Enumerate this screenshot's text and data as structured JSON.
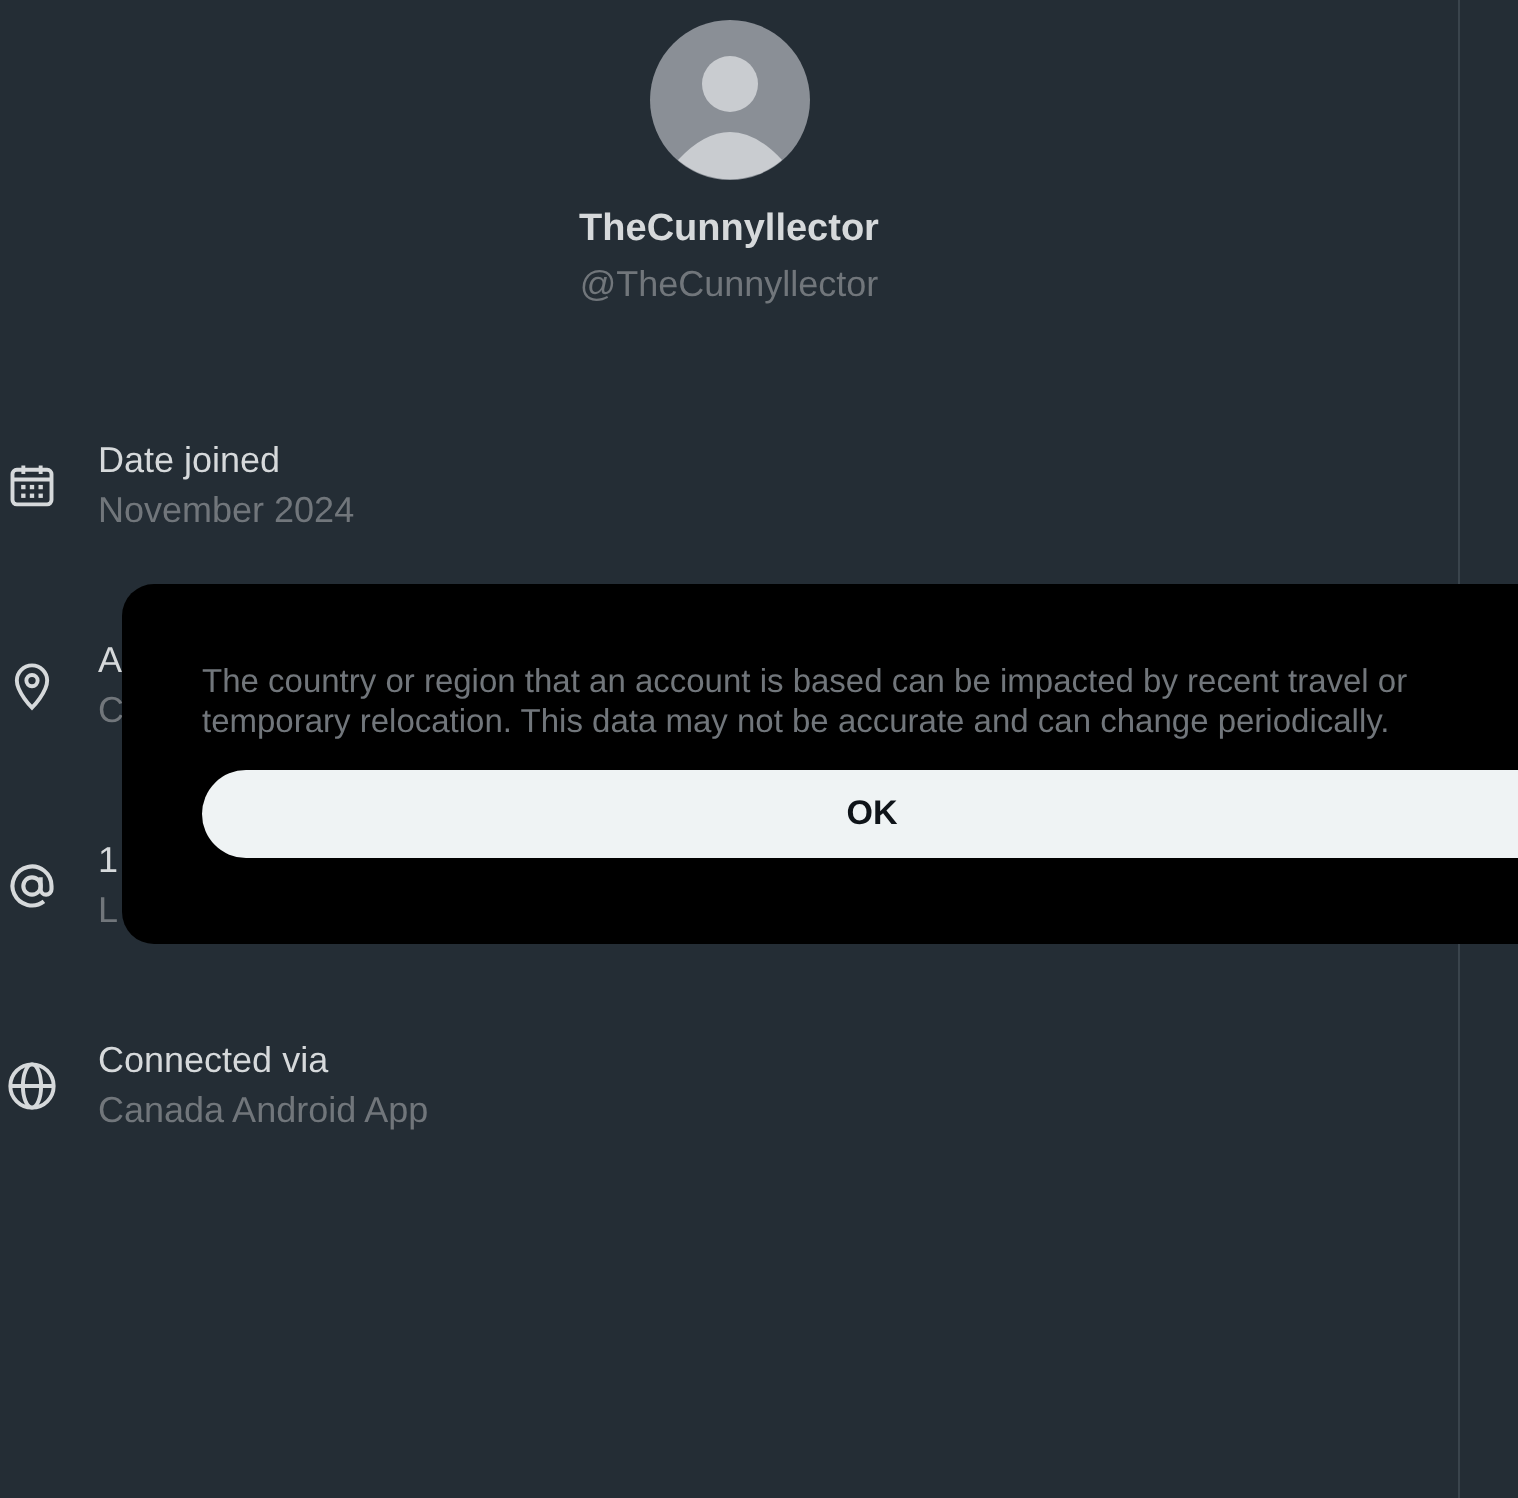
{
  "profile": {
    "display_name": "TheCunnyllector",
    "handle": "@TheCunnyllector"
  },
  "details": [
    {
      "kind": "calendar",
      "title": "Date joined",
      "value": "November 2024"
    },
    {
      "kind": "location",
      "title": "A",
      "value": "C"
    },
    {
      "kind": "at",
      "title": "1",
      "value": "L"
    },
    {
      "kind": "globe",
      "title": "Connected via",
      "value": "Canada Android App"
    }
  ],
  "dialog": {
    "message": "The country or region that an account is based can be impacted by recent travel or temporary relocation. This data may not be accurate and can change periodically.",
    "button": "OK"
  }
}
